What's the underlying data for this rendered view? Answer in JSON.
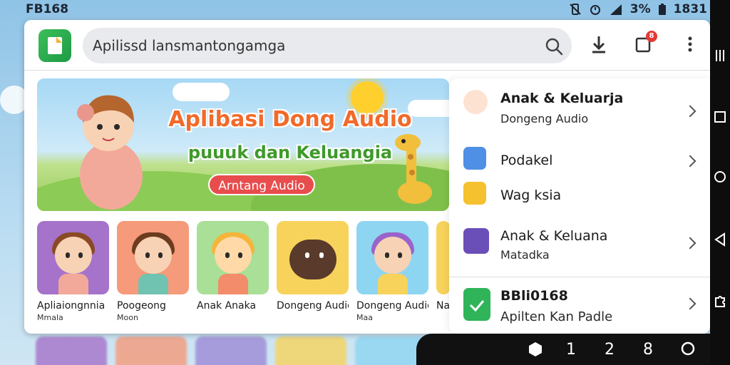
{
  "status_bar": {
    "left_label": "FB168",
    "battery": "3%",
    "time": "1831",
    "icons": [
      "mute-vibrate-icon",
      "alarm-icon",
      "signal-icon",
      "battery-icon"
    ]
  },
  "search": {
    "text": "Apilissd lansmantongamga"
  },
  "toolbar": {
    "notification_count": "8"
  },
  "banner": {
    "title": "Aplibasi Dong Audio",
    "subtitle": "puuuk dan Keluangia",
    "pill": "Arntang Audio"
  },
  "tiles": [
    {
      "label": "Apliaiongnnia",
      "sublabel": "Mmala",
      "color": "#a573c9"
    },
    {
      "label": "Poogeong",
      "sublabel": "Moon",
      "color": "#f59a7a"
    },
    {
      "label": "Anak Anaka",
      "sublabel": "",
      "color": "#a9df96"
    },
    {
      "label": "Dongeng Audio",
      "sublabel": "",
      "color": "#f7d35c"
    },
    {
      "label": "Dongeng Audio",
      "sublabel": "Maa",
      "color": "#8ed5f2"
    },
    {
      "label": "Na",
      "sublabel": "",
      "color": "#f7d35c"
    }
  ],
  "panel": {
    "items": [
      {
        "title": "Anak & Keluarja",
        "subtitle": "Dongeng Audio"
      },
      {
        "title": "Podakel",
        "subtitle": ""
      },
      {
        "title": "Wag ksia",
        "subtitle": ""
      },
      {
        "title": "Anak & Keluana",
        "subtitle": "Matadka"
      },
      {
        "title": "BBli0168",
        "subtitle": "Apilten Kan Padle"
      }
    ]
  },
  "bottom_bar": {
    "items": [
      "1",
      "2",
      "8"
    ]
  }
}
